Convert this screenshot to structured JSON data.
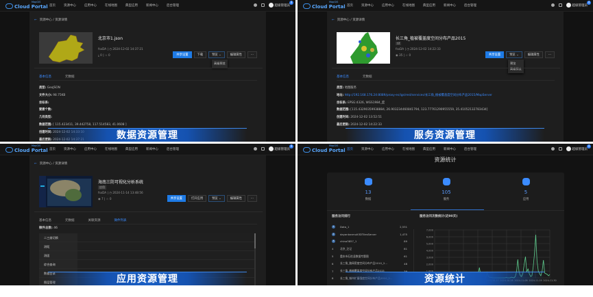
{
  "nav": {
    "logo_brand": "Cloud Portal",
    "logo_sup": "MapGIS",
    "items": [
      "首页",
      "资源中心",
      "应用中心",
      "在线地图",
      "典型应用",
      "新闻中心",
      "后台管理"
    ],
    "user": "超级管理员",
    "badge": "4"
  },
  "breadcrumb": {
    "parent": "资源中心",
    "sep": "/",
    "current": "资源详情",
    "back": "←"
  },
  "data_panel": {
    "title": "北京市1.json",
    "owner": "fsxDA",
    "time": "2024-12-02 14:37:21",
    "downloads": "⤓ 0",
    "stars": "☆ 0",
    "buttons": {
      "share": "共享设置",
      "download": "下载",
      "preview": "预览 ⌄",
      "edit": "编辑属性",
      "more": "···"
    },
    "dropdown": [
      "高级预览"
    ],
    "tabs": [
      "基本信息",
      "元数据"
    ],
    "info": [
      {
        "k": "类型:",
        "v": "GeoJSON"
      },
      {
        "k": "文件大小:",
        "v": "98.75KB"
      },
      {
        "k": "坐标系:",
        "v": ""
      },
      {
        "k": "要素个数:",
        "v": ""
      },
      {
        "k": "几何类型:",
        "v": ""
      },
      {
        "k": "数据范围:",
        "v": "[ 115.423411, 39.442758, 117.514583, 41.0608 ]"
      },
      {
        "k": "创建时间:",
        "v": "2024-12-02 14:33:10"
      },
      {
        "k": "最后更新:",
        "v": "2024-12-02 14:37:21"
      }
    ],
    "banner": "数据资源管理"
  },
  "service_panel": {
    "title": "长三角_植被覆盖度空间分布产品2015",
    "tag": "tif",
    "owner": "fsxDA",
    "time": "2024-12-02 14:22:33",
    "views": "◉ 35",
    "stars": "☆ 0",
    "buttons": {
      "share": "共享设置",
      "preview": "预览 ⌄",
      "edit": "编辑属性",
      "more": "···"
    },
    "dropdown": [
      "预览",
      "高级预览"
    ],
    "tabs": [
      "基本信息",
      "元数据"
    ],
    "info": [
      {
        "k": "类型:",
        "v": "地图服务"
      },
      {
        "k": "地址:",
        "v": "http://192.168.176.24:8089/proxy-es/igs/rest/services/长三角_植被覆盖度空间分布产品2015/MapServer",
        "link": true
      },
      {
        "k": "坐标系:",
        "v": "EPSG:4326, WGS1984_度"
      },
      {
        "k": "数据范围:",
        "v": "[115.43290359938884, 26.903234460841794, 123.77761290955559, 35.41052132783434]"
      },
      {
        "k": "创建时间:",
        "v": "2024-12-02 13:52:51"
      },
      {
        "k": "最后更新:",
        "v": "2024-12-02 14:22:33"
      }
    ],
    "banner": "服务资源管理"
  },
  "app_panel": {
    "title": "海南三防可视化分析系统",
    "tag": "应用",
    "owner": "fsxDA",
    "time": "2024-11-14 13:48:56",
    "views": "◉ 7",
    "stars": "☆ 0",
    "buttons": {
      "share": "共享设置",
      "open": "打开应用",
      "preview": "预览 ⌄",
      "edit": "编辑属性",
      "more": "···"
    },
    "tabs": [
      "基本信息",
      "元数据",
      "关联资源",
      "微件列表"
    ],
    "widget_total_label": "微件总数:",
    "widget_total": "46",
    "widgets": [
      "二三维切换",
      "测距",
      "测面",
      "综合查询",
      "数据目录",
      "图层管理"
    ],
    "banner": "应用资源管理"
  },
  "stats_panel": {
    "title": "资源统计",
    "stats": [
      {
        "num": "13",
        "label": "数据"
      },
      {
        "num": "105",
        "label": "服务"
      },
      {
        "num": "5",
        "label": "应用"
      }
    ],
    "ranking_title": "服务访问排行",
    "ranking": [
      {
        "n": "1",
        "name": "Data_1",
        "count": "2,531"
      },
      {
        "n": "2",
        "name": "dayantanmult3DTilesServer",
        "count": "1,475"
      },
      {
        "n": "3",
        "name": "china3857_1",
        "count": "89"
      },
      {
        "n": "4",
        "name": "北京_注记",
        "count": "81"
      },
      {
        "n": "5",
        "name": "重庆市石柱县数据专题图",
        "count": "61"
      },
      {
        "n": "6",
        "name": "长三角_路网密度空间分布产品2010_2...",
        "count": "48"
      },
      {
        "n": "7",
        "name": "长三角_植被覆盖度空间分布产品2015",
        "count": "39"
      },
      {
        "n": "8",
        "name": "长三角_城市扩展强度空间分布产品2010_2...",
        "count": "36"
      }
    ],
    "chart_title": "服务访问次数统计(近90天)",
    "banner": "资源统计"
  },
  "colors": {
    "accent": "#1e7be6",
    "line": "#5fcf8f",
    "banner": "#1552b0"
  },
  "chart_data": {
    "type": "line",
    "title": "服务访问次数统计(近90天)",
    "ylim": [
      0,
      7000
    ],
    "yticks": [
      "0",
      "1,000",
      "2,000",
      "3,000",
      "4,000",
      "5,000",
      "6,000",
      "7,000"
    ],
    "xticks": [
      "2024-09-03",
      "2024-09-14",
      "2024-09-25",
      "2024-10-06",
      "2024-10-17",
      "2024-10-28",
      "2024-11-08",
      "2024-11-19",
      "2024-11-30"
    ],
    "x_start": "2024-09-01",
    "x_end": "2024-11-30",
    "values": [
      0,
      0,
      0,
      0,
      0,
      0,
      0,
      0,
      0,
      0,
      0,
      0,
      0,
      0,
      0,
      0,
      0,
      0,
      0,
      0,
      0,
      0,
      0,
      0,
      0,
      0,
      0,
      0,
      0,
      0,
      0,
      0,
      50,
      120,
      600,
      1500,
      400,
      50,
      0,
      0,
      0,
      800,
      200,
      50,
      80,
      0,
      0,
      0,
      0,
      0,
      0,
      0,
      0,
      0,
      0,
      0,
      50,
      0,
      0,
      0,
      100,
      50,
      0,
      200,
      900,
      2700,
      800,
      300,
      200,
      700,
      2000,
      3100,
      900,
      1300,
      600,
      200,
      300,
      1500,
      3500,
      6300,
      2500,
      1000,
      600,
      300,
      1000,
      2600,
      700,
      600,
      500,
      300,
      500
    ]
  }
}
